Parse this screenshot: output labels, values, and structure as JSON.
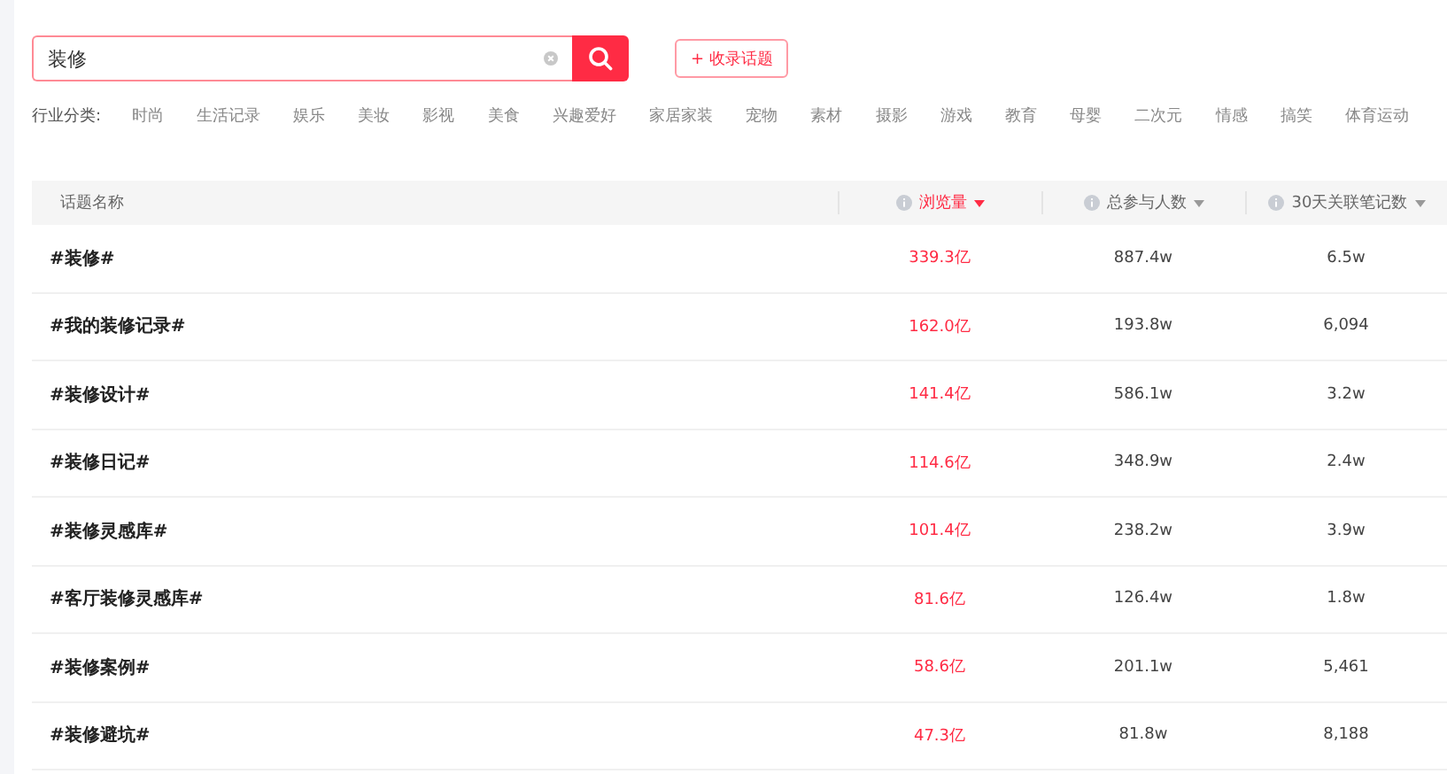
{
  "search": {
    "value": "装修"
  },
  "collect_button": "+ 收录话题",
  "category_filter": {
    "label": "行业分类:",
    "items": [
      "时尚",
      "生活记录",
      "娱乐",
      "美妆",
      "影视",
      "美食",
      "兴趣爱好",
      "家居家装",
      "宠物",
      "素材",
      "摄影",
      "游戏",
      "教育",
      "母婴",
      "二次元",
      "情感",
      "搞笑",
      "体育运动"
    ]
  },
  "table": {
    "columns": [
      {
        "label": "话题名称",
        "kind": "plain",
        "selected": false
      },
      {
        "label": "浏览量",
        "kind": "sortable",
        "selected": true
      },
      {
        "label": "总参与人数",
        "kind": "sortable",
        "selected": false
      },
      {
        "label": "30天关联笔记数",
        "kind": "sortable",
        "selected": false
      }
    ],
    "rows": [
      [
        "#装修#",
        "339.3亿",
        "887.4w",
        "6.5w"
      ],
      [
        "#我的装修记录#",
        "162.0亿",
        "193.8w",
        "6,094"
      ],
      [
        "#装修设计#",
        "141.4亿",
        "586.1w",
        "3.2w"
      ],
      [
        "#装修日记#",
        "114.6亿",
        "348.9w",
        "2.4w"
      ],
      [
        "#装修灵感库#",
        "101.4亿",
        "238.2w",
        "3.9w"
      ],
      [
        "#客厅装修灵感库#",
        "81.6亿",
        "126.4w",
        "1.8w"
      ],
      [
        "#装修案例#",
        "58.6亿",
        "201.1w",
        "5,461"
      ],
      [
        "#装修避坑#",
        "47.3亿",
        "81.8w",
        "8,188"
      ]
    ]
  }
}
